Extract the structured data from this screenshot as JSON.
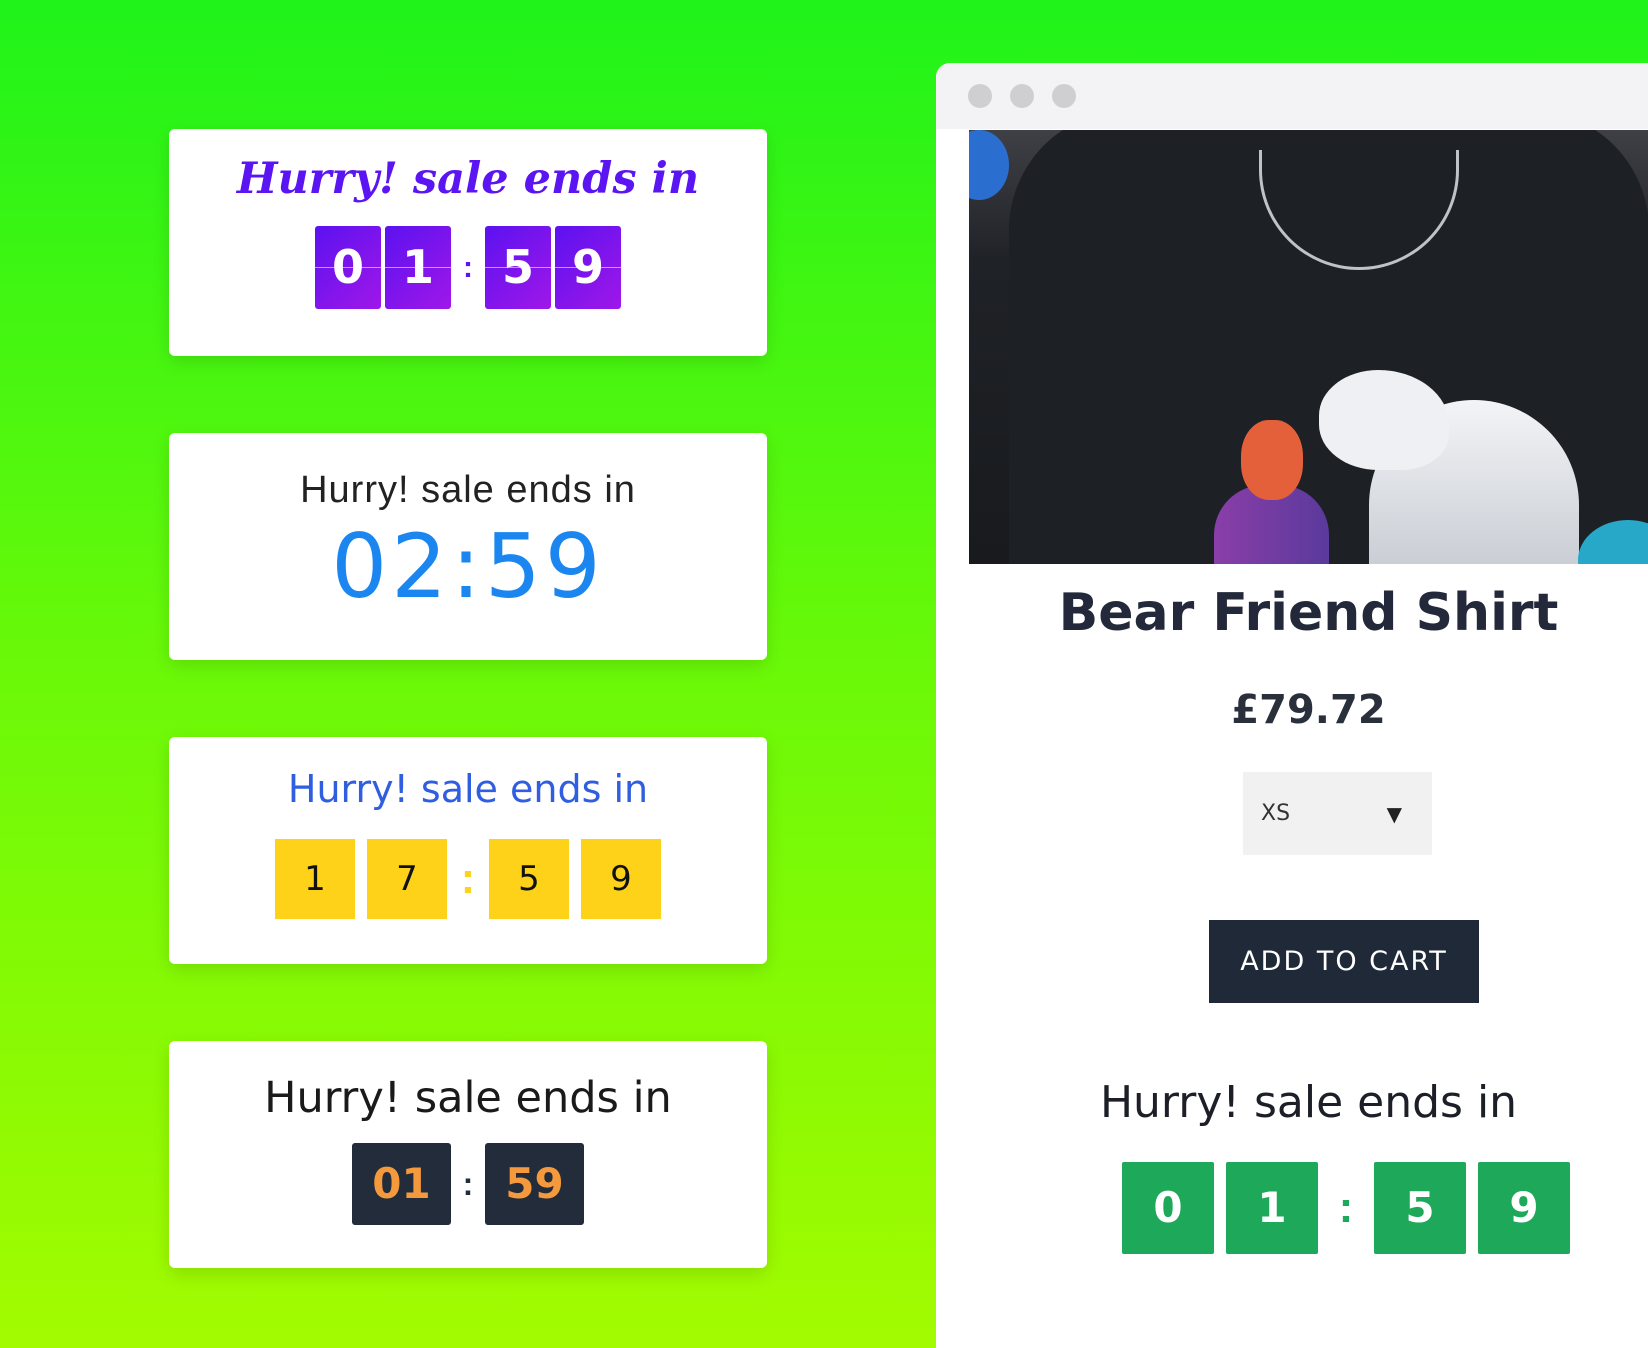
{
  "cards": [
    {
      "title": "Hurry! sale ends in",
      "digits": [
        "0",
        "1",
        "5",
        "9"
      ],
      "separator": ":"
    },
    {
      "title": "Hurry! sale ends in",
      "time": "02:59"
    },
    {
      "title": "Hurry! sale ends in",
      "digits": [
        "1",
        "7",
        "5",
        "9"
      ],
      "separator": ":"
    },
    {
      "title": "Hurry! sale ends in",
      "minutes": "01",
      "seconds": "59",
      "separator": ":"
    }
  ],
  "product": {
    "name": "Bear Friend Shirt",
    "price": "£79.72",
    "size_selected": "XS",
    "add_to_cart_label": "ADD TO CART",
    "countdown_title": "Hurry! sale ends in",
    "countdown_digits": [
      "0",
      "1",
      "5",
      "9"
    ],
    "countdown_separator": ":"
  },
  "colors": {
    "background_top": "#1ff31a",
    "background_bottom": "#a3fb00",
    "flip_gradient_start": "#5b12f0",
    "flip_gradient_end": "#a017e8",
    "big_time": "#1b86f0",
    "yellow_box": "#ffd21a",
    "dark_box": "#232c3b",
    "dark_box_digits": "#f59a3c",
    "green_box": "#1ea95a",
    "button": "#1f2938"
  },
  "icons": [
    "window-dot-icon",
    "dropdown-caret-icon"
  ]
}
